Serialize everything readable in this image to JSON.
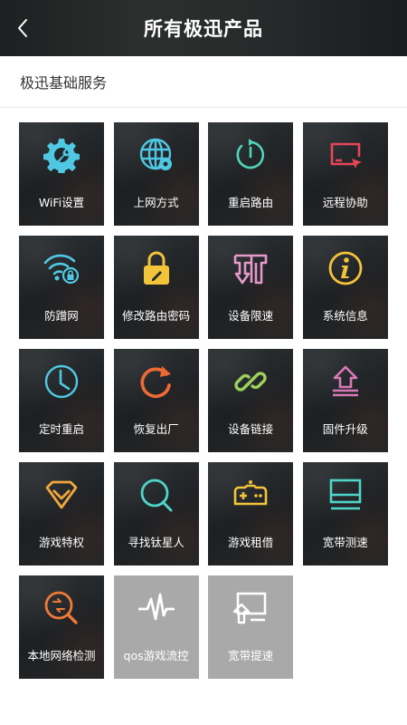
{
  "header": {
    "title": "所有极迅产品"
  },
  "section": {
    "title": "极迅基础服务"
  },
  "items": [
    {
      "label": "WiFi设置",
      "icon": "gear-wrench-icon",
      "color": "#4fc9e3"
    },
    {
      "label": "上网方式",
      "icon": "globe-gear-icon",
      "color": "#4fc9e3"
    },
    {
      "label": "重启路由",
      "icon": "power-restart-icon",
      "color": "#4fd5b9"
    },
    {
      "label": "远程协助",
      "icon": "remote-screen-icon",
      "color": "#e8455a"
    },
    {
      "label": "防蹭网",
      "icon": "wifi-lock-icon",
      "color": "#4fc9e3"
    },
    {
      "label": "修改路由密码",
      "icon": "padlock-icon",
      "color": "#f2c43a"
    },
    {
      "label": "设备限速",
      "icon": "speed-limit-icon",
      "color": "#e59aca"
    },
    {
      "label": "系统信息",
      "icon": "info-icon",
      "color": "#f2c43a"
    },
    {
      "label": "定时重启",
      "icon": "clock-icon",
      "color": "#4fc9e3"
    },
    {
      "label": "恢复出厂",
      "icon": "restore-icon",
      "color": "#ee6a35"
    },
    {
      "label": "设备链接",
      "icon": "link-icon",
      "color": "#9cd15a"
    },
    {
      "label": "固件升级",
      "icon": "upgrade-icon",
      "color": "#d77ab8"
    },
    {
      "label": "游戏特权",
      "icon": "diamond-icon",
      "color": "#f0a73b"
    },
    {
      "label": "寻找钛星人",
      "icon": "search-q-icon",
      "color": "#4fd5c9"
    },
    {
      "label": "游戏租借",
      "icon": "gamepad-icon",
      "color": "#f2c43a"
    },
    {
      "label": "宽带测速",
      "icon": "monitor-icon",
      "color": "#4fd5c9"
    },
    {
      "label": "本地网络检测",
      "icon": "network-scan-icon",
      "color": "#ee7a35"
    },
    {
      "label": "qos游戏流控",
      "icon": "waveform-icon",
      "color": "#ffffff"
    },
    {
      "label": "宽带提速",
      "icon": "broadband-boost-icon",
      "color": "#ffffff"
    }
  ]
}
